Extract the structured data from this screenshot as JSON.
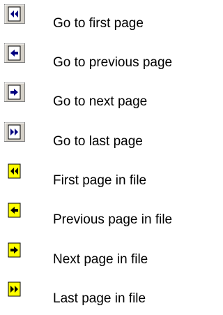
{
  "buttons": [
    {
      "label": "Go to first page",
      "icon": "go-to-first-page-icon"
    },
    {
      "label": "Go to previous page",
      "icon": "go-to-previous-page-icon"
    },
    {
      "label": "Go to next page",
      "icon": "go-to-next-page-icon"
    },
    {
      "label": "Go to last page",
      "icon": "go-to-last-page-icon"
    },
    {
      "label": "First page in file",
      "icon": "first-page-in-file-icon"
    },
    {
      "label": "Previous page in file",
      "icon": "previous-page-in-file-icon"
    },
    {
      "label": "Next page in file",
      "icon": "next-page-in-file-icon"
    },
    {
      "label": "Last page in file",
      "icon": "last-page-in-file-icon"
    }
  ],
  "colors": {
    "page_white": "#ffffff",
    "page_yellow": "#ffff00",
    "arrow_blue": "#000080",
    "arrow_black": "#000000",
    "button_face": "#d4d0c8",
    "button_shadow": "#808080"
  }
}
